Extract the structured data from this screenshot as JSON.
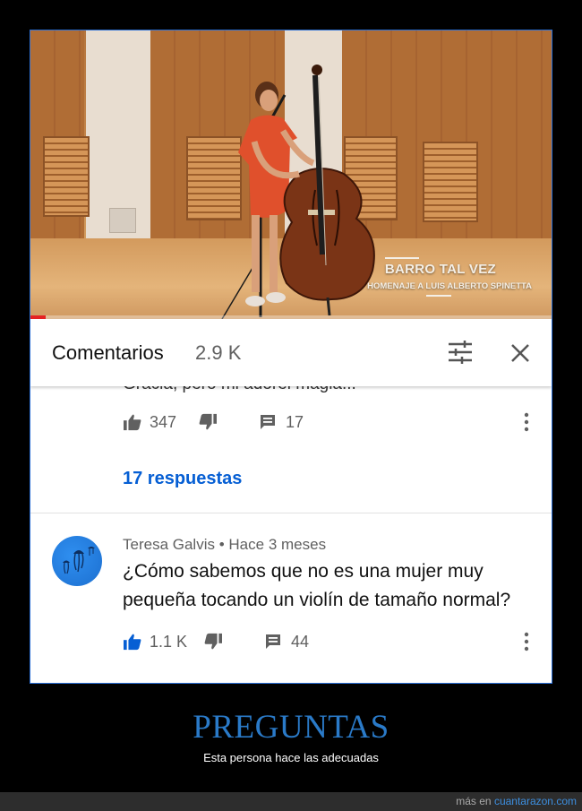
{
  "video": {
    "caption_title": "BARRO TAL VEZ",
    "caption_subtitle": "HOMENAJE A LUIS ALBERTO SPINETTA",
    "progress": 0.03
  },
  "comments_panel": {
    "title": "Comentarios",
    "count": "2.9 K",
    "filter_icon": "sort-filter-icon",
    "close_icon": "close-icon"
  },
  "first_comment": {
    "cut_off_text": "Gracia, pero mi adorei magia...",
    "likes": "347",
    "replies_count": "17",
    "replies_link": "17 respuestas"
  },
  "second_comment": {
    "author": "Teresa Galvis",
    "separator": "•",
    "time": "Hace 3 meses",
    "text": "¿Cómo sabemos que no es una mujer muy pequeña tocando un violín de tamaño normal?",
    "likes": "1.1 K",
    "replies_count": "44"
  },
  "post": {
    "headline": "PREGUNTAS",
    "subline": "Esta persona hace las adecuadas"
  },
  "footer": {
    "prefix": "más en",
    "site": "cuantarazon.com"
  },
  "colors": {
    "link_blue": "#065fd4",
    "headline_blue": "#2a7ac8",
    "liked_thumb": "#065fd4",
    "progress_red": "#e52222"
  }
}
